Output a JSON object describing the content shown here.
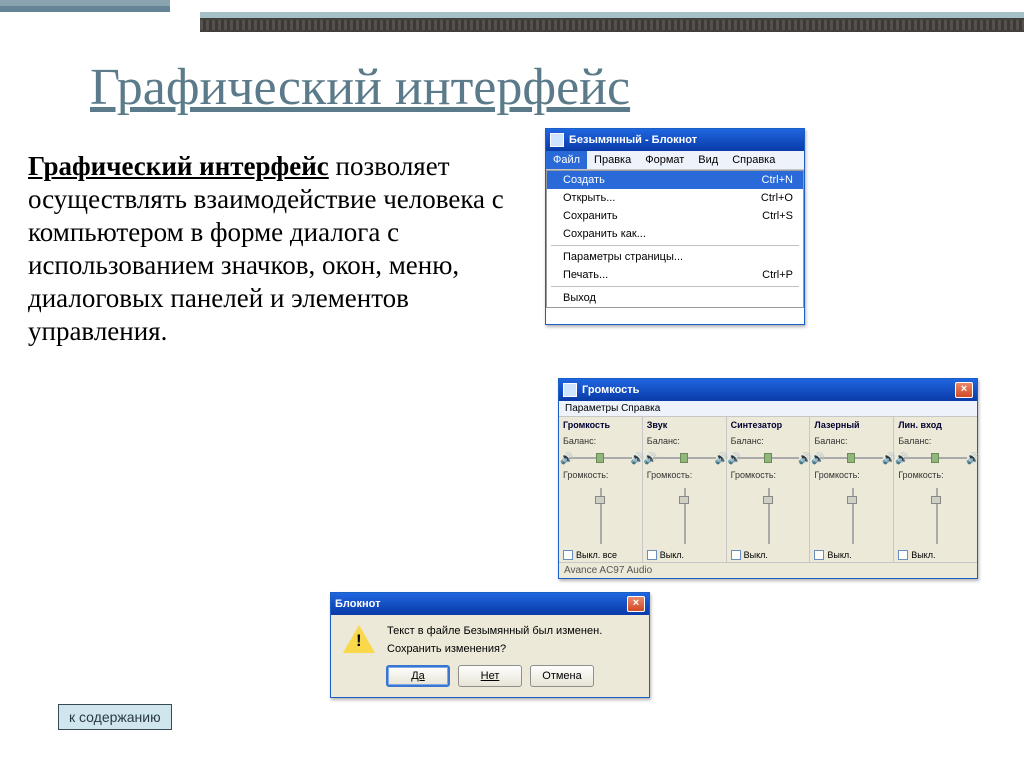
{
  "slide": {
    "title": "Графический интерфейс",
    "body_bold": "Графический интерфейс",
    "body_rest": " позволяет осуществлять взаимодействие человека с компьютером в форме диалога с использованием значков, окон, меню, диалоговых панелей и элементов управления.",
    "nav_button": "к содержанию"
  },
  "notepad": {
    "title": "Безымянный - Блокнот",
    "file_menu": "Файл",
    "menus": [
      "Правка",
      "Формат",
      "Вид",
      "Справка"
    ],
    "items": [
      {
        "label": "Создать",
        "shortcut": "Ctrl+N",
        "selected": true
      },
      {
        "label": "Открыть...",
        "shortcut": "Ctrl+O"
      },
      {
        "label": "Сохранить",
        "shortcut": "Ctrl+S"
      },
      {
        "label": "Сохранить как...",
        "shortcut": ""
      },
      {
        "sep": true
      },
      {
        "label": "Параметры страницы...",
        "shortcut": ""
      },
      {
        "label": "Печать...",
        "shortcut": "Ctrl+P"
      },
      {
        "sep": true
      },
      {
        "label": "Выход",
        "shortcut": ""
      }
    ]
  },
  "mixer": {
    "title": "Громкость",
    "menu": "Параметры  Справка",
    "balance_label": "Баланс:",
    "volume_label": "Громкость:",
    "channels": [
      {
        "name": "Громкость",
        "mute": "Выкл. все"
      },
      {
        "name": "Звук",
        "mute": "Выкл."
      },
      {
        "name": "Синтезатор",
        "mute": "Выкл."
      },
      {
        "name": "Лазерный",
        "mute": "Выкл."
      },
      {
        "name": "Лин. вход",
        "mute": "Выкл."
      }
    ],
    "status": "Avance AC97 Audio"
  },
  "savedlg": {
    "title": "Блокнот",
    "line1": "Текст в файле Безымянный был изменен.",
    "line2": "Сохранить изменения?",
    "yes": "Да",
    "no": "Нет",
    "cancel": "Отмена"
  }
}
